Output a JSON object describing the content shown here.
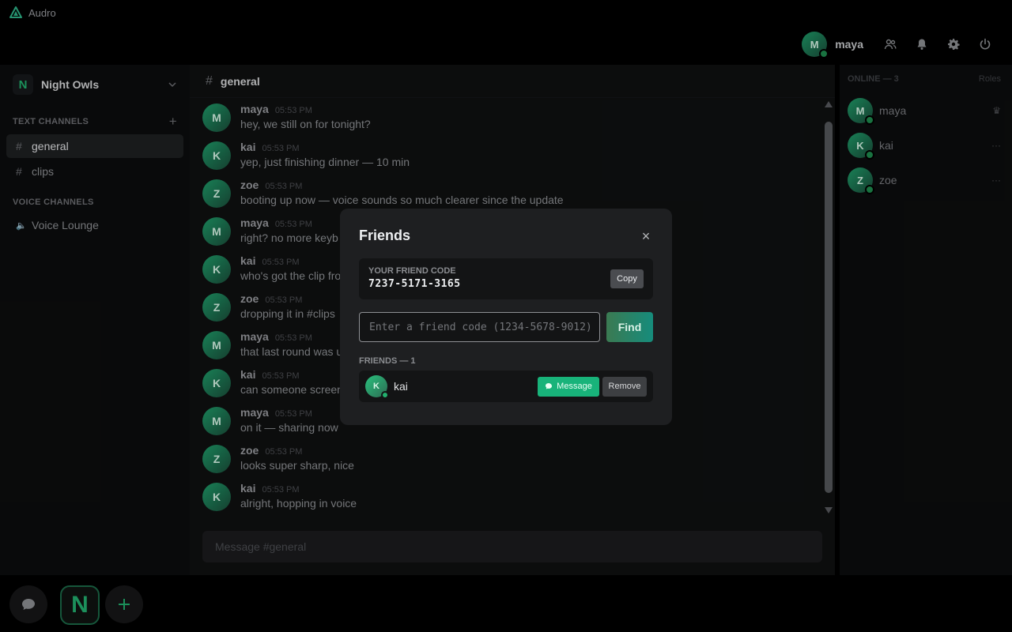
{
  "app": {
    "title": "Audro"
  },
  "user": {
    "name": "maya",
    "initial": "M"
  },
  "server": {
    "name": "Night Owls",
    "initial": "N"
  },
  "sidebar": {
    "text_header": "TEXT CHANNELS",
    "text_channels": [
      {
        "name": "general"
      },
      {
        "name": "clips"
      }
    ],
    "voice_header": "VOICE CHANNELS",
    "voice_channels": [
      {
        "name": "Voice Lounge"
      }
    ]
  },
  "chat": {
    "channel": "general",
    "composer_placeholder": "Message #general",
    "messages": [
      {
        "author": "maya",
        "initial": "M",
        "time": "05:53 PM",
        "text": "hey, we still on for tonight?"
      },
      {
        "author": "kai",
        "initial": "K",
        "time": "05:53 PM",
        "text": "yep, just finishing dinner — 10 min"
      },
      {
        "author": "zoe",
        "initial": "Z",
        "time": "05:53 PM",
        "text": "booting up now — voice sounds so much clearer since the update"
      },
      {
        "author": "maya",
        "initial": "M",
        "time": "05:53 PM",
        "text": "right? no more keyb"
      },
      {
        "author": "kai",
        "initial": "K",
        "time": "05:53 PM",
        "text": "who's got the clip fro"
      },
      {
        "author": "zoe",
        "initial": "Z",
        "time": "05:53 PM",
        "text": "dropping it in #clips"
      },
      {
        "author": "maya",
        "initial": "M",
        "time": "05:53 PM",
        "text": "that last round was u"
      },
      {
        "author": "kai",
        "initial": "K",
        "time": "05:53 PM",
        "text": "can someone screen"
      },
      {
        "author": "maya",
        "initial": "M",
        "time": "05:53 PM",
        "text": "on it — sharing now"
      },
      {
        "author": "zoe",
        "initial": "Z",
        "time": "05:53 PM",
        "text": "looks super sharp, nice"
      },
      {
        "author": "kai",
        "initial": "K",
        "time": "05:53 PM",
        "text": "alright, hopping in voice"
      }
    ]
  },
  "members": {
    "header": "ONLINE — 3",
    "roles_label": "Roles",
    "list": [
      {
        "name": "maya",
        "initial": "M",
        "extra": "♛"
      },
      {
        "name": "kai",
        "initial": "K",
        "extra": "···"
      },
      {
        "name": "zoe",
        "initial": "Z",
        "extra": "···"
      }
    ]
  },
  "modal": {
    "title": "Friends",
    "close": "×",
    "code_label": "YOUR FRIEND CODE",
    "code_value": "7237-5171-3165",
    "copy_label": "Copy",
    "find_placeholder": "Enter a friend code (1234-5678-9012)",
    "find_label": "Find",
    "friends_header": "FRIENDS — 1",
    "friends": [
      {
        "name": "kai",
        "initial": "K"
      }
    ],
    "message_label": "Message",
    "remove_label": "Remove"
  },
  "colors": {
    "accent": "#18b37a",
    "online": "#1f8c4f",
    "background": "#000000"
  }
}
